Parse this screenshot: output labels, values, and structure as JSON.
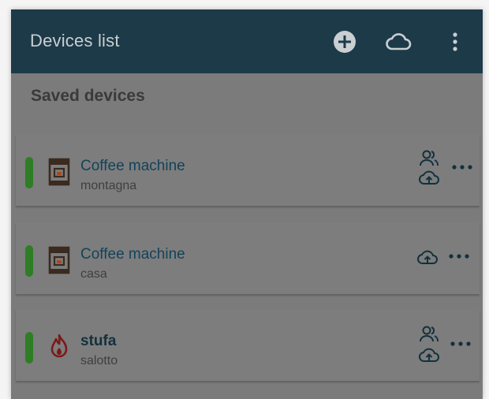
{
  "app_bar": {
    "title": "Devices list",
    "actions": [
      {
        "name": "add-device",
        "icon": "plus-circle-icon"
      },
      {
        "name": "cloud",
        "icon": "cloud-icon"
      },
      {
        "name": "more",
        "icon": "more-vertical-icon"
      }
    ]
  },
  "section": {
    "title": "Saved devices"
  },
  "devices": [
    {
      "name": "Coffee machine",
      "location": "montagna",
      "type": "coffee-machine",
      "status_color": "#2f7d25",
      "shared": true,
      "cloud": true
    },
    {
      "name": "Coffee machine",
      "location": "casa",
      "type": "coffee-machine",
      "status_color": "#2f7d25",
      "shared": false,
      "cloud": true
    },
    {
      "name": "stufa",
      "location": "salotto",
      "type": "stove-flame",
      "status_color": "#2f7d25",
      "shared": true,
      "cloud": true
    }
  ],
  "colors": {
    "app_bar_bg": "#1d3a48",
    "accent": "#13435a",
    "status_on": "#2f7d25",
    "overlay_bg": "#7b7b7b"
  }
}
